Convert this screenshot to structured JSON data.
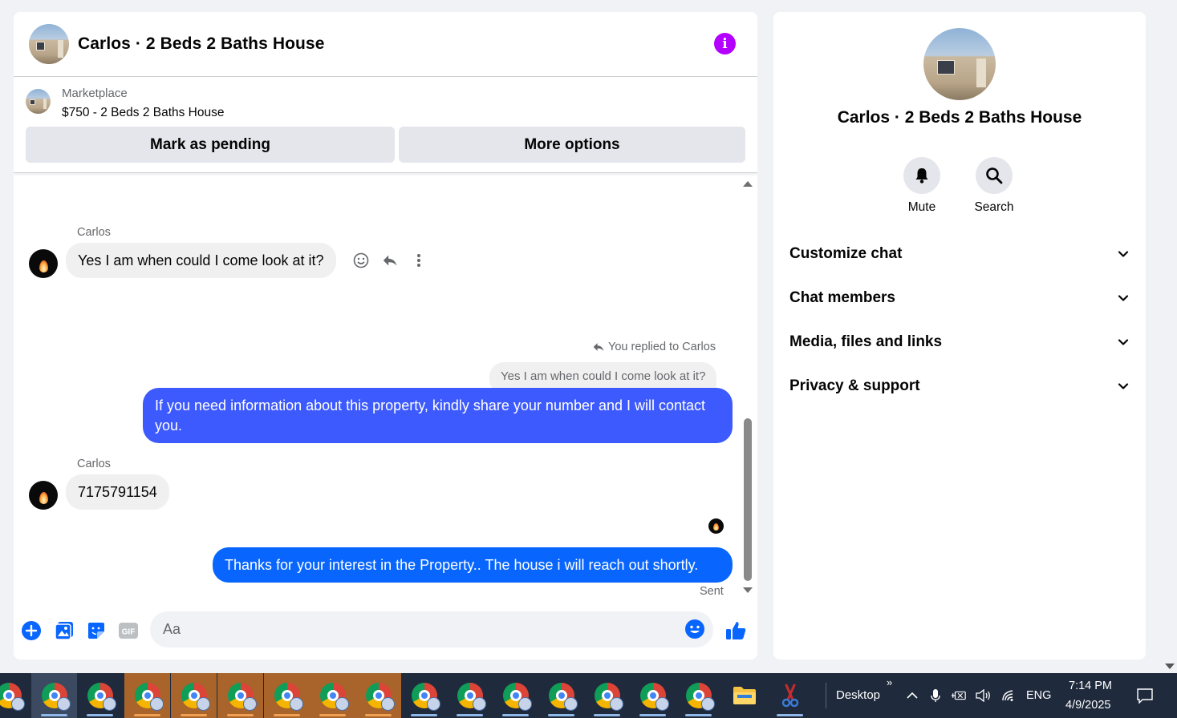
{
  "chat": {
    "title": "Carlos · 2 Beds 2 Baths House",
    "marketplace_label": "Marketplace",
    "listing": "$750 - 2 Beds 2 Baths House",
    "mark_pending_label": "Mark as pending",
    "more_options_label": "More options"
  },
  "messages": {
    "m1_sender": "Carlos",
    "m1_text": "Yes I am when could I come look at it?",
    "reply_note": "You replied to Carlos",
    "quoted_text": "Yes I am when could I come look at it?",
    "m2_text": "If you need information about this property, kindly share  your number and I will contact you.",
    "m3_sender": "Carlos",
    "m3_text": "7175791154",
    "m4_text": "Thanks for your interest in the Property.. The house i will reach  out shortly.",
    "status": "Sent"
  },
  "composer": {
    "placeholder": "Aa"
  },
  "info": {
    "title": "Carlos · 2 Beds 2 Baths House",
    "mute_label": "Mute",
    "search_label": "Search",
    "sections": [
      "Customize chat",
      "Chat members",
      "Media, files and links",
      "Privacy & support"
    ]
  },
  "taskbar": {
    "desktop_label": "Desktop",
    "language": "ENG",
    "time": "7:14 PM",
    "date": "4/9/2025"
  },
  "colors": {
    "accent_blue": "#0866ff",
    "reply_bubble": "#3d5afe",
    "info_icon": "#b400ff",
    "taskbar": "#1f2a3c"
  }
}
